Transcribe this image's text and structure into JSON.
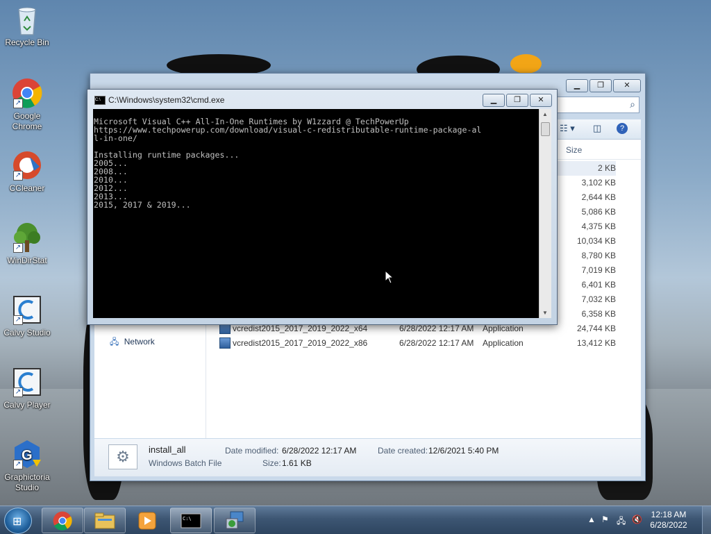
{
  "desktop": {
    "icons": [
      {
        "label": "Recycle Bin",
        "icon": "recycle-bin-icon"
      },
      {
        "label": "Google Chrome",
        "icon": "chrome-icon"
      },
      {
        "label": "CCleaner",
        "icon": "ccleaner-icon"
      },
      {
        "label": "WinDirStat",
        "icon": "windirstat-icon"
      },
      {
        "label": "Calvy Studio",
        "icon": "calvy-studio-icon"
      },
      {
        "label": "Calvy Player",
        "icon": "calvy-player-icon"
      },
      {
        "label": "Graphictoria Studio",
        "icon": "graphictoria-icon"
      }
    ]
  },
  "explorer": {
    "column_size": "Size",
    "nav_network": "Network",
    "rows": [
      {
        "name": "",
        "date": "",
        "type": "",
        "size": "2 KB",
        "selected": true
      },
      {
        "name": "",
        "date": "",
        "type": "",
        "size": "3,102 KB"
      },
      {
        "name": "",
        "date": "",
        "type": "",
        "size": "2,644 KB"
      },
      {
        "name": "",
        "date": "",
        "type": "",
        "size": "5,086 KB"
      },
      {
        "name": "",
        "date": "",
        "type": "",
        "size": "4,375 KB"
      },
      {
        "name": "",
        "date": "",
        "type": "",
        "size": "10,034 KB"
      },
      {
        "name": "",
        "date": "",
        "type": "",
        "size": "8,780 KB"
      },
      {
        "name": "",
        "date": "",
        "type": "",
        "size": "7,019 KB"
      },
      {
        "name": "",
        "date": "",
        "type": "",
        "size": "6,401 KB"
      },
      {
        "name": "",
        "date": "",
        "type": "",
        "size": "7,032 KB"
      },
      {
        "name": "",
        "date": "",
        "type": "",
        "size": "6,358 KB"
      },
      {
        "name": "vcredist2015_2017_2019_2022_x64",
        "date": "6/28/2022 12:17 AM",
        "type": "Application",
        "size": "24,744 KB"
      },
      {
        "name": "vcredist2015_2017_2019_2022_x86",
        "date": "6/28/2022 12:17 AM",
        "type": "Application",
        "size": "13,412 KB"
      }
    ],
    "details": {
      "filename": "install_all",
      "filetype": "Windows Batch File",
      "date_modified_label": "Date modified:",
      "date_modified": "6/28/2022 12:17 AM",
      "size_label": "Size:",
      "size": "1.61 KB",
      "date_created_label": "Date created:",
      "date_created": "12/6/2021 5:40 PM"
    }
  },
  "cmd": {
    "title": "C:\\Windows\\system32\\cmd.exe",
    "output": "Microsoft Visual C++ All-In-One Runtimes by W1zzard @ TechPowerUp\nhttps://www.techpowerup.com/download/visual-c-redistributable-runtime-package-al\nl-in-one/\n\nInstalling runtime packages...\n2005...\n2008...\n2010...\n2012...\n2013...\n2015, 2017 & 2019..."
  },
  "taskbar": {
    "apps": [
      "chrome-icon",
      "explorer-icon",
      "media-player-icon",
      "cmd-icon",
      "installer-icon"
    ],
    "time": "12:18 AM",
    "date": "6/28/2022"
  }
}
